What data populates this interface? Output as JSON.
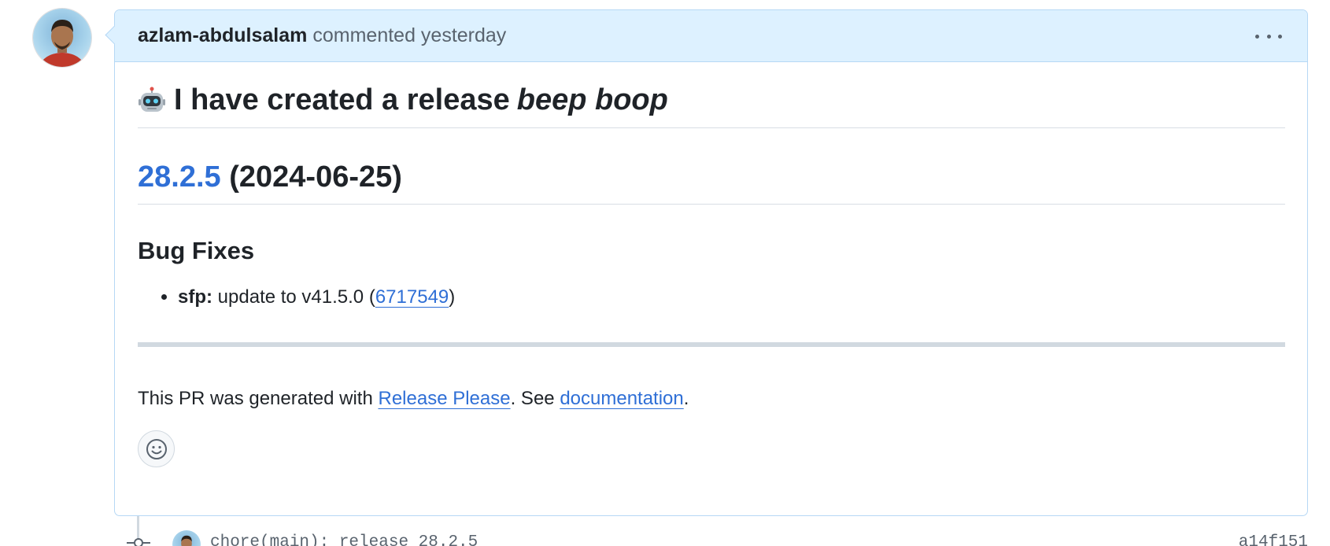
{
  "comment": {
    "author": "azlam-abdulsalam",
    "action": "commented yesterday",
    "more_options_icon": "kebab-horizontal-icon",
    "avatar_icon": "user-avatar",
    "heading": {
      "emoji_icon": "robot-icon",
      "text": "I have created a release",
      "emphasis": "beep boop"
    },
    "release": {
      "version": "28.2.5",
      "date": "(2024-06-25)"
    },
    "section": {
      "title": "Bug Fixes",
      "items": [
        {
          "scope": "sfp:",
          "text": "update to v41.5.0 (",
          "commit_link": "6717549",
          "closing": ")"
        }
      ]
    },
    "footer": {
      "prefix": "This PR was generated with ",
      "link1": "Release Please",
      "middle": ". See ",
      "link2": "documentation",
      "suffix": "."
    },
    "reaction_icon": "smiley-icon"
  },
  "timeline": {
    "commit_icon": "git-commit-icon",
    "commit_message": "chore(main): release 28.2.5",
    "commit_sha": "a14f151"
  },
  "colors": {
    "header_bg": "#ddf1ff",
    "border": "#b6d8f5",
    "link": "#2f6fd6",
    "muted": "#59636e"
  }
}
